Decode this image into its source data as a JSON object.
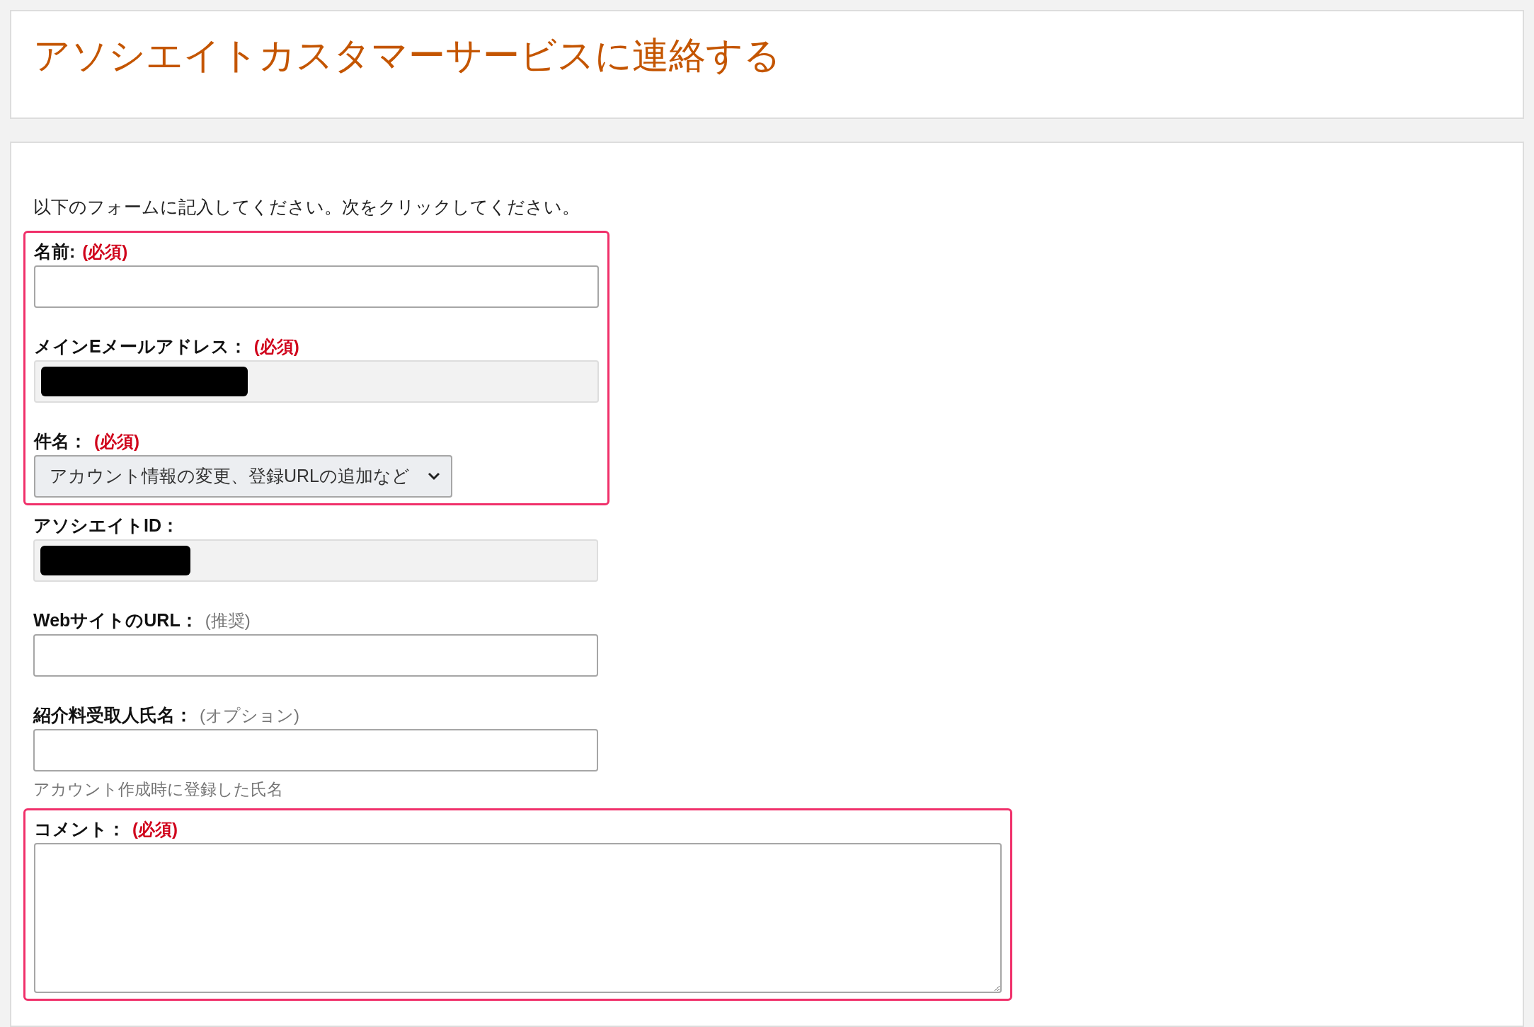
{
  "header": {
    "title": "アソシエイトカスタマーサービスに連絡する"
  },
  "form": {
    "intro": "以下のフォームに記入してください。次をクリックしてください。",
    "groups": [
      {
        "highlighted": true,
        "fields": [
          {
            "kind": "text",
            "label": "名前:",
            "tag": {
              "text": "(必須)",
              "kind": "required"
            }
          },
          {
            "kind": "readonly",
            "label": "メインEメールアドレス：",
            "tag": {
              "text": "(必須)",
              "kind": "required"
            },
            "redacted": true
          },
          {
            "kind": "select",
            "label": "件名：",
            "tag": {
              "text": "(必須)",
              "kind": "required"
            },
            "value": "アカウント情報の変更、登録URLの追加など"
          }
        ]
      },
      {
        "highlighted": false,
        "fields": [
          {
            "kind": "readonly",
            "label": "アソシエイトID：",
            "redacted": true
          },
          {
            "kind": "text",
            "label": "WebサイトのURL：",
            "tag": {
              "text": "(推奨)",
              "kind": "optional"
            }
          },
          {
            "kind": "text",
            "label": "紹介料受取人氏名：",
            "tag": {
              "text": "(オプション)",
              "kind": "optional"
            },
            "hint": "アカウント作成時に登録した氏名"
          }
        ]
      },
      {
        "highlighted": true,
        "fields": [
          {
            "kind": "textarea",
            "label": "コメント：",
            "tag": {
              "text": "(必須)",
              "kind": "required"
            }
          }
        ]
      }
    ]
  }
}
